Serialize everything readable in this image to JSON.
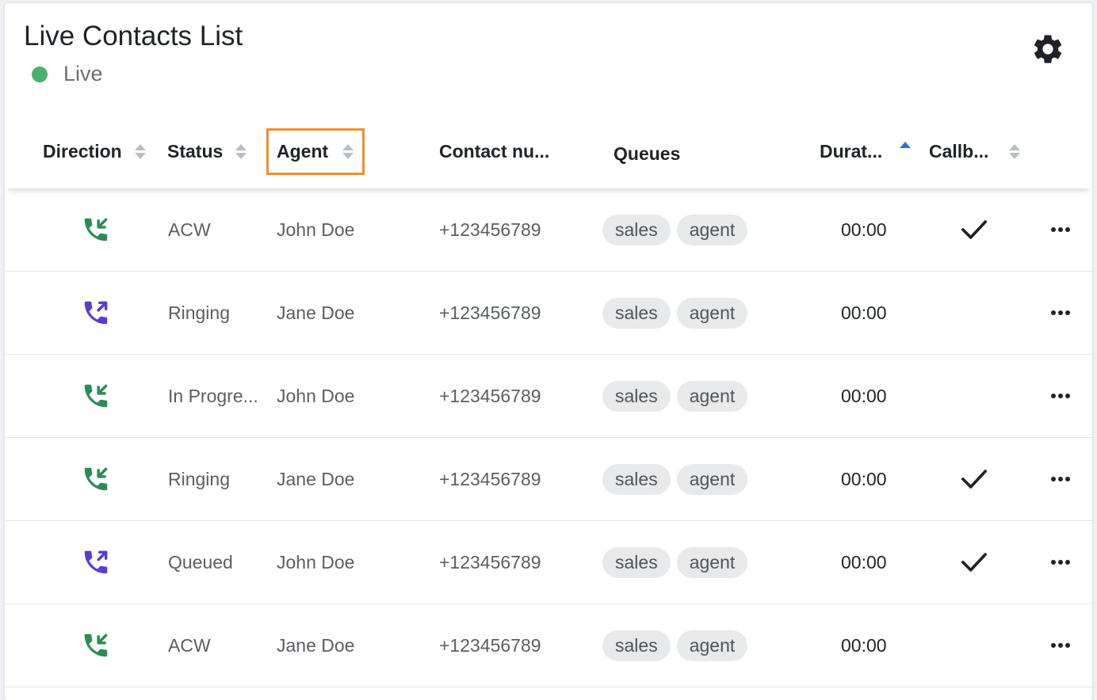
{
  "header": {
    "title": "Live Contacts List",
    "live_label": "Live",
    "live_color": "#4caf6e",
    "settings_icon": "gear-icon"
  },
  "columns": [
    {
      "key": "direction",
      "label": "Direction",
      "sortable": true,
      "sort": "none"
    },
    {
      "key": "status",
      "label": "Status",
      "sortable": true,
      "sort": "none"
    },
    {
      "key": "agent",
      "label": "Agent",
      "sortable": true,
      "sort": "none",
      "highlighted": true
    },
    {
      "key": "contact_number",
      "label": "Contact nu...",
      "sortable": false
    },
    {
      "key": "queues",
      "label": "Queues",
      "sortable": false
    },
    {
      "key": "duration",
      "label": "Durat...",
      "sortable": true,
      "sort": "ascending"
    },
    {
      "key": "callback",
      "label": "Callb...",
      "sortable": true,
      "sort": "none"
    }
  ],
  "colors": {
    "inbound": "#2e8b57",
    "outbound": "#5b3bd6",
    "highlight_border": "#ef8f2e",
    "sort_active": "#2f6fd6"
  },
  "rows": [
    {
      "direction": "inbound",
      "direction_icon": "phone-incoming-icon",
      "status": "ACW",
      "agent": "John Doe",
      "contact_number": "+123456789",
      "queues": [
        "sales",
        "agent"
      ],
      "duration": "00:00",
      "callback": true
    },
    {
      "direction": "outbound",
      "direction_icon": "phone-outgoing-icon",
      "status": "Ringing",
      "agent": "Jane Doe",
      "contact_number": "+123456789",
      "queues": [
        "sales",
        "agent"
      ],
      "duration": "00:00",
      "callback": false
    },
    {
      "direction": "inbound",
      "direction_icon": "phone-incoming-icon",
      "status": "In Progre...",
      "agent": "John Doe",
      "contact_number": "+123456789",
      "queues": [
        "sales",
        "agent"
      ],
      "duration": "00:00",
      "callback": false
    },
    {
      "direction": "inbound",
      "direction_icon": "phone-incoming-icon",
      "status": "Ringing",
      "agent": "Jane Doe",
      "contact_number": "+123456789",
      "queues": [
        "sales",
        "agent"
      ],
      "duration": "00:00",
      "callback": true
    },
    {
      "direction": "outbound",
      "direction_icon": "phone-outgoing-icon",
      "status": "Queued",
      "agent": "John Doe",
      "contact_number": "+123456789",
      "queues": [
        "sales",
        "agent"
      ],
      "duration": "00:00",
      "callback": true
    },
    {
      "direction": "inbound",
      "direction_icon": "phone-incoming-icon",
      "status": "ACW",
      "agent": "Jane Doe",
      "contact_number": "+123456789",
      "queues": [
        "sales",
        "agent"
      ],
      "duration": "00:00",
      "callback": false
    }
  ]
}
